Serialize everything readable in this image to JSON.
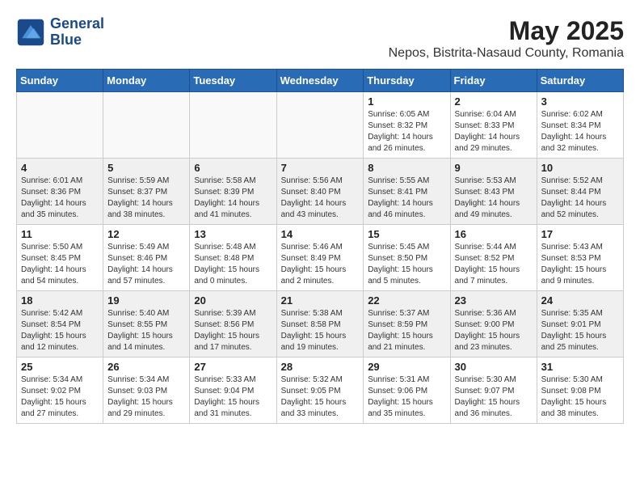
{
  "header": {
    "logo_line1": "General",
    "logo_line2": "Blue",
    "month_year": "May 2025",
    "location": "Nepos, Bistrita-Nasaud County, Romania"
  },
  "weekdays": [
    "Sunday",
    "Monday",
    "Tuesday",
    "Wednesday",
    "Thursday",
    "Friday",
    "Saturday"
  ],
  "weeks": [
    [
      {
        "day": "",
        "info": ""
      },
      {
        "day": "",
        "info": ""
      },
      {
        "day": "",
        "info": ""
      },
      {
        "day": "",
        "info": ""
      },
      {
        "day": "1",
        "info": "Sunrise: 6:05 AM\nSunset: 8:32 PM\nDaylight: 14 hours\nand 26 minutes."
      },
      {
        "day": "2",
        "info": "Sunrise: 6:04 AM\nSunset: 8:33 PM\nDaylight: 14 hours\nand 29 minutes."
      },
      {
        "day": "3",
        "info": "Sunrise: 6:02 AM\nSunset: 8:34 PM\nDaylight: 14 hours\nand 32 minutes."
      }
    ],
    [
      {
        "day": "4",
        "info": "Sunrise: 6:01 AM\nSunset: 8:36 PM\nDaylight: 14 hours\nand 35 minutes."
      },
      {
        "day": "5",
        "info": "Sunrise: 5:59 AM\nSunset: 8:37 PM\nDaylight: 14 hours\nand 38 minutes."
      },
      {
        "day": "6",
        "info": "Sunrise: 5:58 AM\nSunset: 8:39 PM\nDaylight: 14 hours\nand 41 minutes."
      },
      {
        "day": "7",
        "info": "Sunrise: 5:56 AM\nSunset: 8:40 PM\nDaylight: 14 hours\nand 43 minutes."
      },
      {
        "day": "8",
        "info": "Sunrise: 5:55 AM\nSunset: 8:41 PM\nDaylight: 14 hours\nand 46 minutes."
      },
      {
        "day": "9",
        "info": "Sunrise: 5:53 AM\nSunset: 8:43 PM\nDaylight: 14 hours\nand 49 minutes."
      },
      {
        "day": "10",
        "info": "Sunrise: 5:52 AM\nSunset: 8:44 PM\nDaylight: 14 hours\nand 52 minutes."
      }
    ],
    [
      {
        "day": "11",
        "info": "Sunrise: 5:50 AM\nSunset: 8:45 PM\nDaylight: 14 hours\nand 54 minutes."
      },
      {
        "day": "12",
        "info": "Sunrise: 5:49 AM\nSunset: 8:46 PM\nDaylight: 14 hours\nand 57 minutes."
      },
      {
        "day": "13",
        "info": "Sunrise: 5:48 AM\nSunset: 8:48 PM\nDaylight: 15 hours\nand 0 minutes."
      },
      {
        "day": "14",
        "info": "Sunrise: 5:46 AM\nSunset: 8:49 PM\nDaylight: 15 hours\nand 2 minutes."
      },
      {
        "day": "15",
        "info": "Sunrise: 5:45 AM\nSunset: 8:50 PM\nDaylight: 15 hours\nand 5 minutes."
      },
      {
        "day": "16",
        "info": "Sunrise: 5:44 AM\nSunset: 8:52 PM\nDaylight: 15 hours\nand 7 minutes."
      },
      {
        "day": "17",
        "info": "Sunrise: 5:43 AM\nSunset: 8:53 PM\nDaylight: 15 hours\nand 9 minutes."
      }
    ],
    [
      {
        "day": "18",
        "info": "Sunrise: 5:42 AM\nSunset: 8:54 PM\nDaylight: 15 hours\nand 12 minutes."
      },
      {
        "day": "19",
        "info": "Sunrise: 5:40 AM\nSunset: 8:55 PM\nDaylight: 15 hours\nand 14 minutes."
      },
      {
        "day": "20",
        "info": "Sunrise: 5:39 AM\nSunset: 8:56 PM\nDaylight: 15 hours\nand 17 minutes."
      },
      {
        "day": "21",
        "info": "Sunrise: 5:38 AM\nSunset: 8:58 PM\nDaylight: 15 hours\nand 19 minutes."
      },
      {
        "day": "22",
        "info": "Sunrise: 5:37 AM\nSunset: 8:59 PM\nDaylight: 15 hours\nand 21 minutes."
      },
      {
        "day": "23",
        "info": "Sunrise: 5:36 AM\nSunset: 9:00 PM\nDaylight: 15 hours\nand 23 minutes."
      },
      {
        "day": "24",
        "info": "Sunrise: 5:35 AM\nSunset: 9:01 PM\nDaylight: 15 hours\nand 25 minutes."
      }
    ],
    [
      {
        "day": "25",
        "info": "Sunrise: 5:34 AM\nSunset: 9:02 PM\nDaylight: 15 hours\nand 27 minutes."
      },
      {
        "day": "26",
        "info": "Sunrise: 5:34 AM\nSunset: 9:03 PM\nDaylight: 15 hours\nand 29 minutes."
      },
      {
        "day": "27",
        "info": "Sunrise: 5:33 AM\nSunset: 9:04 PM\nDaylight: 15 hours\nand 31 minutes."
      },
      {
        "day": "28",
        "info": "Sunrise: 5:32 AM\nSunset: 9:05 PM\nDaylight: 15 hours\nand 33 minutes."
      },
      {
        "day": "29",
        "info": "Sunrise: 5:31 AM\nSunset: 9:06 PM\nDaylight: 15 hours\nand 35 minutes."
      },
      {
        "day": "30",
        "info": "Sunrise: 5:30 AM\nSunset: 9:07 PM\nDaylight: 15 hours\nand 36 minutes."
      },
      {
        "day": "31",
        "info": "Sunrise: 5:30 AM\nSunset: 9:08 PM\nDaylight: 15 hours\nand 38 minutes."
      }
    ]
  ]
}
